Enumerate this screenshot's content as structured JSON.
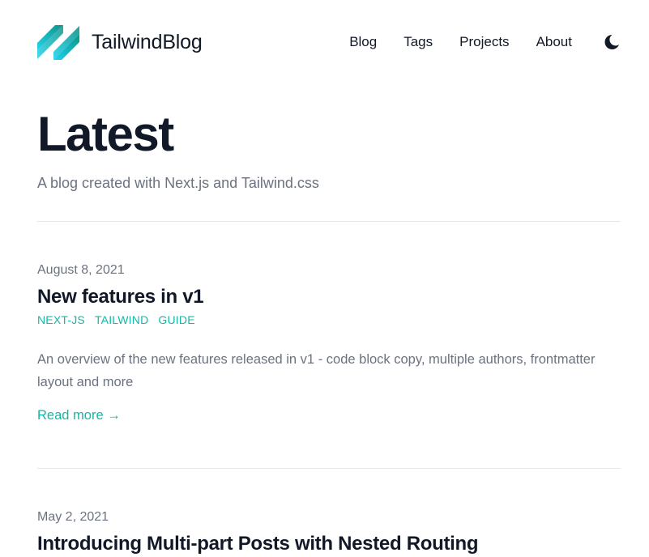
{
  "header": {
    "brand_name": "TailwindBlog",
    "logo_icon": "tailwind-slash-logo",
    "nav": [
      {
        "label": "Blog"
      },
      {
        "label": "Tags"
      },
      {
        "label": "Projects"
      },
      {
        "label": "About"
      }
    ],
    "theme_icon": "moon-icon"
  },
  "hero": {
    "title": "Latest",
    "subtitle": "A blog created with Next.js and Tailwind.css"
  },
  "posts": [
    {
      "date": "August 8, 2021",
      "title": "New features in v1",
      "tags": [
        "next-js",
        "tailwind",
        "guide"
      ],
      "summary": "An overview of the new features released in v1 - code block copy, multiple authors, frontmatter layout and more",
      "read_more": "Read more →"
    },
    {
      "date": "May 2, 2021",
      "title": "Introducing Multi-part Posts with Nested Routing"
    }
  ],
  "colors": {
    "accent": "#14b8a6",
    "logo_start": "#22d3ee",
    "logo_end": "#0d9488",
    "text": "#111827",
    "muted": "#6b7280",
    "divider": "#e5e7eb"
  }
}
